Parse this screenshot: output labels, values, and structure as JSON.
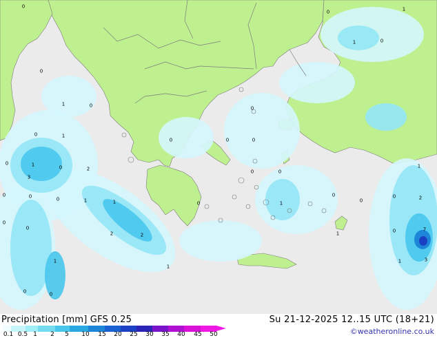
{
  "header": {
    "title": "Precipitation [mm]  GFS 0.25",
    "datetime": "Su 21-12-2025 12..15 UTC (18+21)",
    "credit": "©weatheronline.co.uk"
  },
  "legend": {
    "labels": [
      "0.1",
      "0.5",
      "1",
      "2",
      "5",
      "10",
      "15",
      "20",
      "25",
      "30",
      "35",
      "40",
      "45",
      "50"
    ],
    "colors": [
      "#f0fcfe",
      "#c6f6fc",
      "#a0eef8",
      "#74dcf0",
      "#48c6ec",
      "#2aa8e0",
      "#1e86d8",
      "#1a62d2",
      "#1c40c4",
      "#2c24b6",
      "#7a14c8",
      "#b010d2",
      "#d810d8",
      "#f018e4"
    ]
  },
  "map": {
    "colors": {
      "sea": "#ebebeb",
      "land": "#bff08f",
      "border": "#7b7b7b",
      "coast": "#7b7b7b"
    },
    "values": [
      "0",
      "0",
      "1",
      "0",
      "0",
      "0",
      "0",
      "1",
      "1",
      "0",
      "2",
      "3",
      "0",
      "0",
      "0",
      "1",
      "1",
      "2",
      "0",
      "0",
      "0",
      "0",
      "0",
      "1",
      "0",
      "0",
      "0",
      "0",
      "0",
      "1",
      "2",
      "2",
      "0",
      "1",
      "0",
      "1",
      "7",
      "1",
      "3",
      "1",
      "0",
      "0",
      "1",
      "0",
      "1",
      "0"
    ]
  }
}
